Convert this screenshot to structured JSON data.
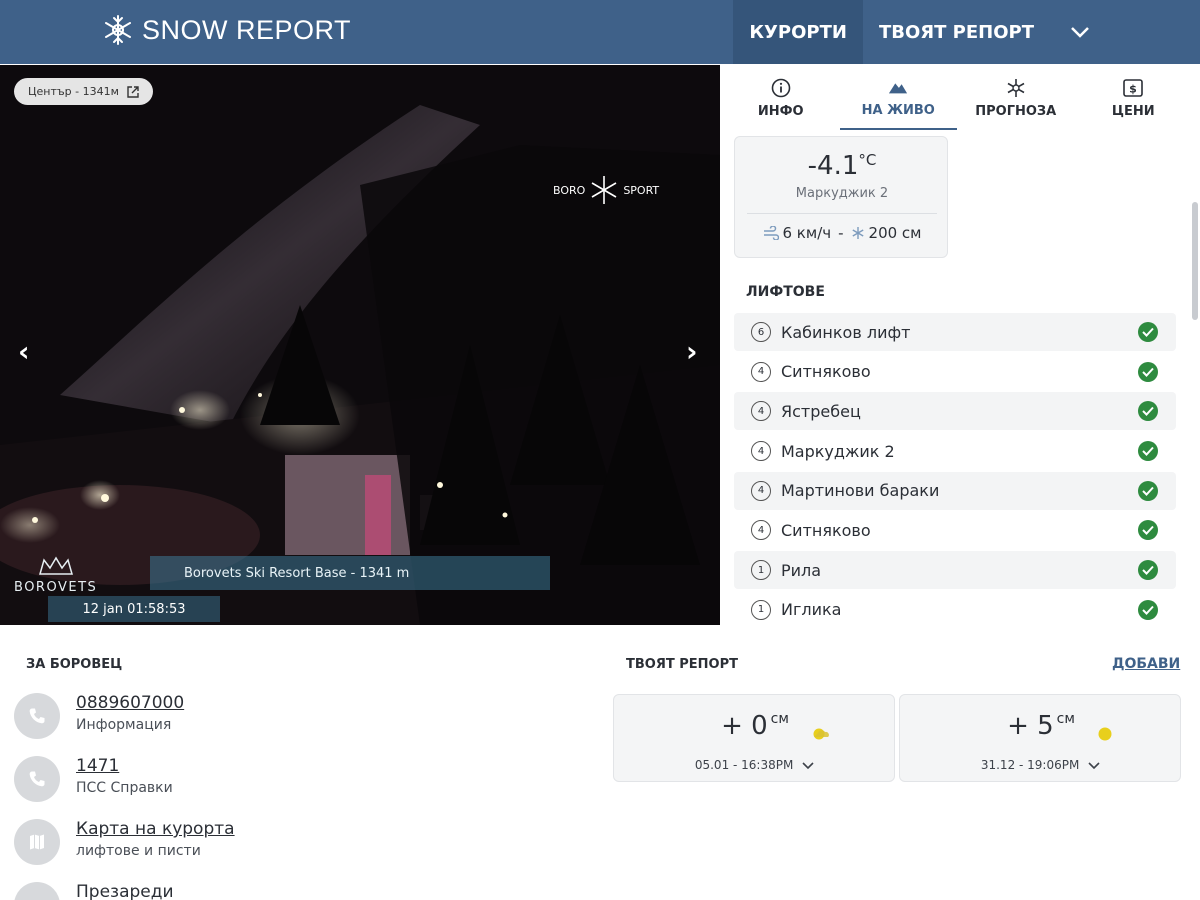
{
  "header": {
    "brand": "SNOW REPORT",
    "nav": [
      {
        "label": "КУРОРТИ",
        "active": true
      },
      {
        "label": "ТВОЯТ РЕПОРТ",
        "active": false
      }
    ]
  },
  "webcam": {
    "badge": "Център - 1341м",
    "watermark_left": "BORO",
    "watermark_right": "SPORT",
    "caption": "Borovets Ski Resort Base - 1341 m",
    "timestamp": "12 jan 01:58:53",
    "resort_mark": "BOROVETS"
  },
  "tabs": [
    {
      "label": "ИНФО",
      "icon": "info-icon",
      "active": false
    },
    {
      "label": "НА ЖИВО",
      "icon": "mountain-icon",
      "active": true
    },
    {
      "label": "ПРОГНОЗА",
      "icon": "snowflake-icon",
      "active": false
    },
    {
      "label": "ЦЕНИ",
      "icon": "price-icon",
      "active": false
    }
  ],
  "weather": {
    "temperature": "-4.1",
    "unit": "°C",
    "station": "Маркуджик 2",
    "wind": "6 км/ч",
    "separator": "-",
    "snow": "200 см"
  },
  "lifts": {
    "title": "ЛИФТОВЕ",
    "items": [
      {
        "seats": "6",
        "name": "Кабинков лифт"
      },
      {
        "seats": "4",
        "name": "Ситняково"
      },
      {
        "seats": "4",
        "name": "Ястребец"
      },
      {
        "seats": "4",
        "name": "Маркуджик 2"
      },
      {
        "seats": "4",
        "name": "Мартинови бараки"
      },
      {
        "seats": "4",
        "name": "Ситняково"
      },
      {
        "seats": "1",
        "name": "Рила"
      },
      {
        "seats": "1",
        "name": "Иглика"
      }
    ]
  },
  "about": {
    "title": "ЗА БОРОВЕЦ",
    "contacts": [
      {
        "main": "0889607000",
        "sub": "Информация",
        "icon": "phone-icon"
      },
      {
        "main": "1471",
        "sub": "ПСС Справки",
        "icon": "phone-icon"
      },
      {
        "main": "Карта на курорта",
        "sub": "лифтове и писти",
        "icon": "map-icon"
      },
      {
        "main": "Презареди",
        "sub": "",
        "icon": "refresh-icon"
      }
    ]
  },
  "reports": {
    "title": "ТВОЯТ РЕПОРТ",
    "add_label": "ДОБАВИ",
    "items": [
      {
        "value": "+ 0",
        "unit": "см",
        "date": "05.01 - 16:38PM",
        "weather": "sun-cloud-icon"
      },
      {
        "value": "+ 5",
        "unit": "см",
        "date": "31.12 - 19:06PM",
        "weather": "sun-icon"
      }
    ]
  },
  "colors": {
    "header": "#3f6189",
    "ok": "#2e8b3f",
    "sun": "#e8cf1c"
  }
}
